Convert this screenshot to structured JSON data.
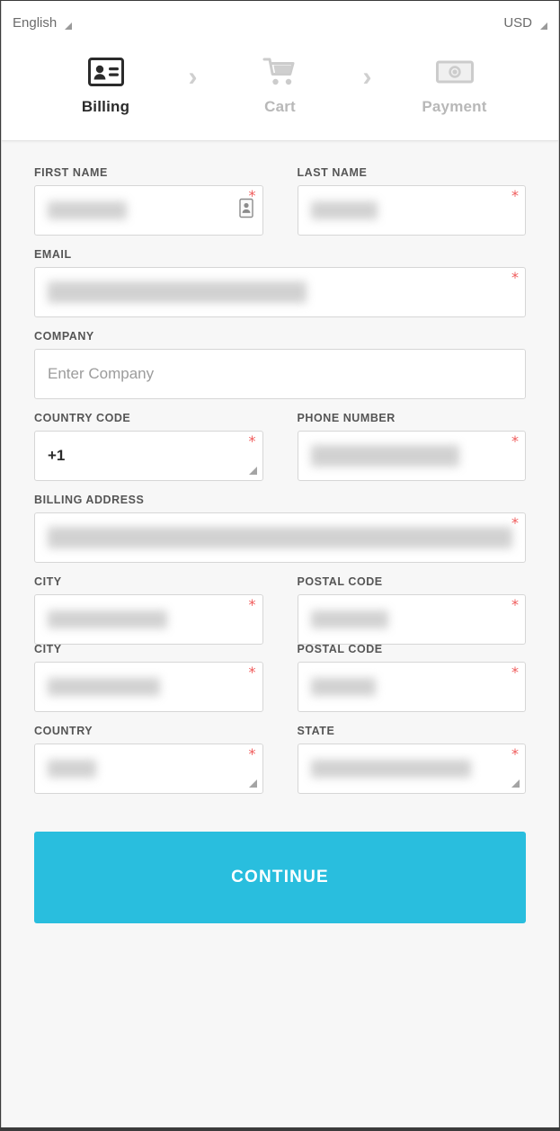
{
  "utility": {
    "language": "English",
    "currency": "USD"
  },
  "stepper": {
    "separator": "›",
    "steps": [
      {
        "label": "Billing",
        "icon": "id-card-icon",
        "state": "active"
      },
      {
        "label": "Cart",
        "icon": "cart-icon",
        "state": "inactive"
      },
      {
        "label": "Payment",
        "icon": "banknote-icon",
        "state": "inactive"
      }
    ]
  },
  "form": {
    "required_marker": "*",
    "fields": {
      "first_name": {
        "label": "FIRST NAME",
        "value": "",
        "placeholder": "",
        "required": true,
        "redacted": true,
        "redacted_width": 88,
        "type": "text",
        "icon": "contact-card-icon"
      },
      "last_name": {
        "label": "LAST NAME",
        "value": "",
        "placeholder": "",
        "required": true,
        "redacted": true,
        "redacted_width": 74,
        "type": "text"
      },
      "email": {
        "label": "EMAIL",
        "value": "",
        "placeholder": "",
        "required": true,
        "redacted": true,
        "redacted_width": 288,
        "type": "email"
      },
      "company": {
        "label": "COMPANY",
        "value": "",
        "placeholder": "Enter Company",
        "required": false,
        "redacted": false,
        "type": "text"
      },
      "country_code": {
        "label": "COUNTRY CODE",
        "value": "+1",
        "placeholder": "",
        "required": true,
        "redacted": false,
        "type": "select"
      },
      "phone_number": {
        "label": "PHONE NUMBER",
        "value": "",
        "placeholder": "",
        "required": true,
        "redacted": true,
        "redacted_width": 165,
        "type": "tel"
      },
      "billing_address": {
        "label": "BILLING ADDRESS",
        "value": "",
        "placeholder": "",
        "required": true,
        "redacted": true,
        "redacted_width": 520,
        "type": "text"
      },
      "city": {
        "label": "CITY",
        "value": "",
        "placeholder": "",
        "required": true,
        "redacted": true,
        "redacted_width": 133,
        "type": "text"
      },
      "postal_code": {
        "label": "POSTAL CODE",
        "value": "",
        "placeholder": "",
        "required": true,
        "redacted": true,
        "redacted_width": 86,
        "type": "text"
      },
      "city_2": {
        "label": "CITY",
        "value": "",
        "placeholder": "",
        "required": true,
        "redacted": true,
        "redacted_width": 125,
        "type": "text"
      },
      "postal_code_2": {
        "label": "POSTAL CODE",
        "value": "",
        "placeholder": "",
        "required": true,
        "redacted": true,
        "redacted_width": 72,
        "type": "text"
      },
      "country": {
        "label": "COUNTRY",
        "value": "",
        "placeholder": "",
        "required": true,
        "redacted": true,
        "redacted_width": 54,
        "type": "select"
      },
      "state": {
        "label": "STATE",
        "value": "",
        "placeholder": "",
        "required": true,
        "redacted": true,
        "redacted_width": 178,
        "type": "select"
      }
    }
  },
  "actions": {
    "continue_label": "CONTINUE"
  },
  "colors": {
    "accent": "#29bede",
    "required": "#f05b5b",
    "page_background": "#f7f7f7",
    "panel_background": "#ffffff",
    "label_text": "#555555",
    "placeholder_text": "#9c9c9c",
    "step_inactive": "#b8b8b8"
  }
}
